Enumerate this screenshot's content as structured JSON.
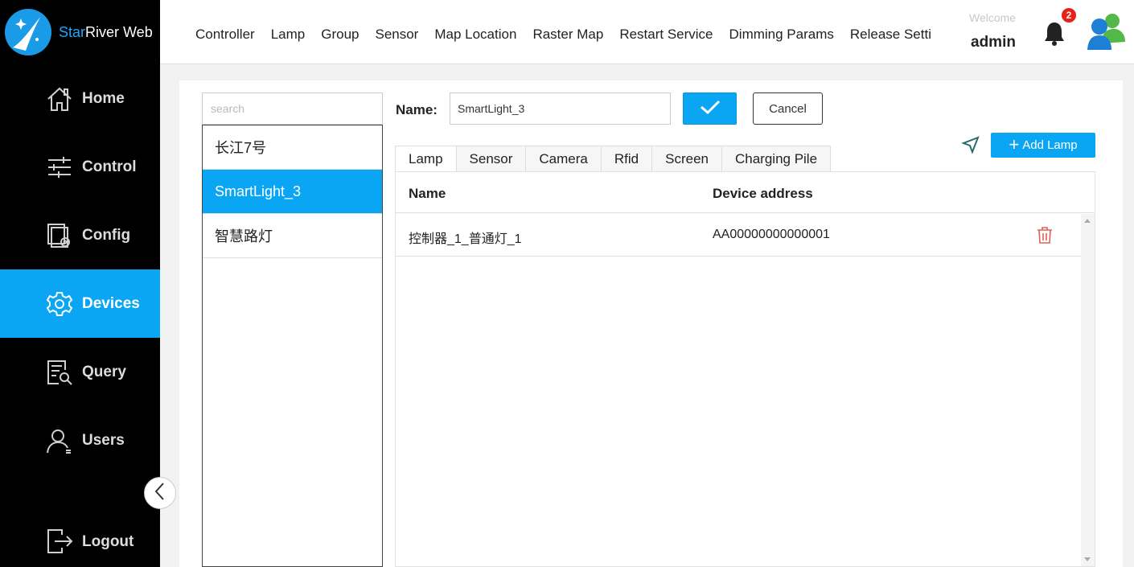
{
  "app": {
    "brand_prefix": "Star",
    "brand_suffix": "River Web"
  },
  "sidebar": {
    "items": [
      {
        "label": "Home",
        "icon": "home-icon"
      },
      {
        "label": "Control",
        "icon": "sliders-icon"
      },
      {
        "label": "Config",
        "icon": "config-icon"
      },
      {
        "label": "Devices",
        "icon": "gear-icon",
        "active": true
      },
      {
        "label": "Query",
        "icon": "query-icon"
      },
      {
        "label": "Users",
        "icon": "user-icon"
      }
    ],
    "logout_label": "Logout"
  },
  "topnav": {
    "items": [
      "Controller",
      "Lamp",
      "Group",
      "Sensor",
      "Map Location",
      "Raster Map",
      "Restart Service",
      "Dimming Params",
      "Release Settings"
    ],
    "welcome": "Welcome",
    "username": "admin",
    "notification_count": "2"
  },
  "group_list": {
    "search_placeholder": "search",
    "items": [
      "长江7号",
      "SmartLight_3",
      "智慧路灯"
    ],
    "selected_index": 1
  },
  "editor": {
    "name_label": "Name:",
    "name_value": "SmartLight_3",
    "cancel_label": "Cancel",
    "add_label": "Add Lamp"
  },
  "tabs": [
    "Lamp",
    "Sensor",
    "Camera",
    "Rfid",
    "Screen",
    "Charging Pile"
  ],
  "table": {
    "columns": [
      "Name",
      "Device address"
    ],
    "rows": [
      {
        "name": "控制器_1_普通灯_1",
        "address": "AA00000000000001"
      }
    ]
  },
  "colors": {
    "accent": "#0aa6f4",
    "sidebar_bg": "#000000",
    "delete": "#e0605a",
    "badge": "#e8201a"
  }
}
